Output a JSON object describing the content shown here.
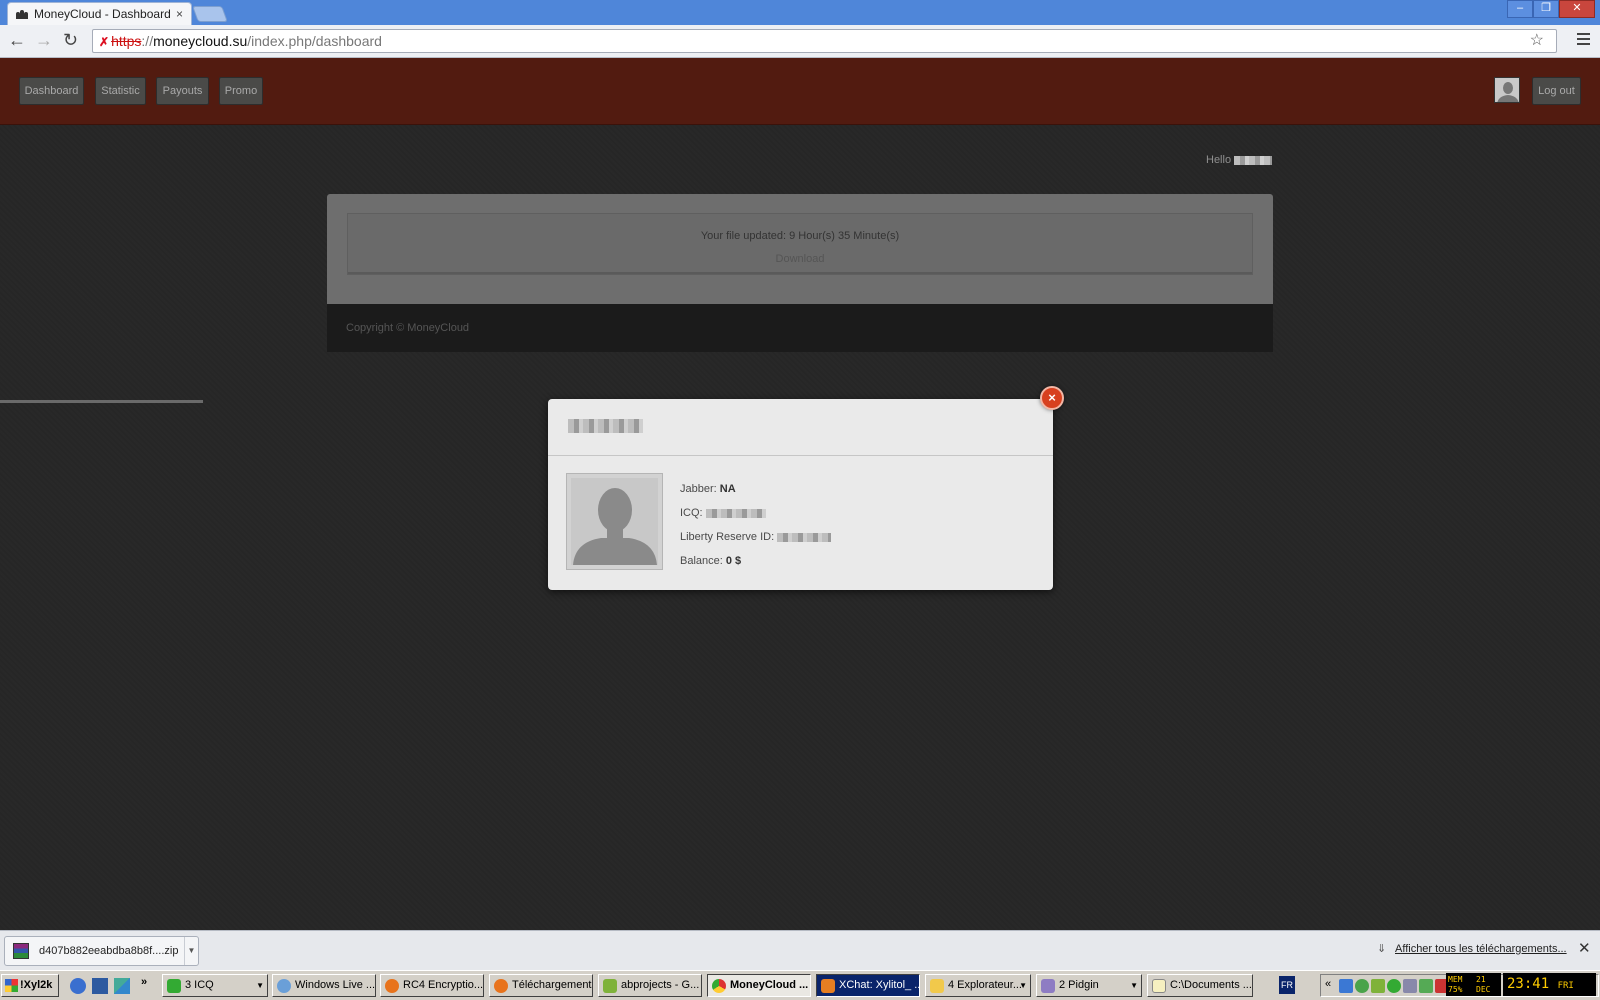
{
  "browser": {
    "tab_title": "MoneyCloud - Dashboard",
    "tab_close": "×",
    "url_scheme": "https",
    "url_sep": "://",
    "url_host": "moneycloud.su",
    "url_path": "/index.php/dashboard",
    "window_controls": [
      "‒",
      "❐",
      "✕"
    ]
  },
  "site": {
    "nav": [
      "Dashboard",
      "Statistic",
      "Payouts",
      "Promo"
    ],
    "logout_label": "Log out",
    "hello_label": "Hello",
    "file_updated": "Your file updated: 9 Hour(s) 35 Minute(s)",
    "download_label": "Download",
    "copyright": "Copyright © MoneyCloud"
  },
  "modal": {
    "close_label": "×",
    "jabber_label": "Jabber:",
    "jabber_value": "NA",
    "icq_label": "ICQ:",
    "lr_label": "Liberty Reserve ID:",
    "balance_label": "Balance:",
    "balance_value": "0 $"
  },
  "downloads": {
    "file_name": "d407b882eeabdba8b8f....zip",
    "show_all": "Afficher tous les téléchargements...",
    "close": "✕"
  },
  "taskbar": {
    "start_label": "!Xyl2k",
    "buttons": [
      "3 ICQ",
      "Windows Live ...",
      "RC4 Encryptio...",
      "Téléchargements",
      "abprojects - G...",
      "MoneyCloud ...",
      "XChat: Xylitol_ ...",
      "4 Explorateur...",
      "2 Pidgin",
      "C:\\Documents ..."
    ],
    "lang": "FR",
    "mem_label": "MEM",
    "mem_value": "75%",
    "date_day": "21",
    "date_month": "DEC",
    "clock": "23:41",
    "clock_day": "FRI"
  }
}
